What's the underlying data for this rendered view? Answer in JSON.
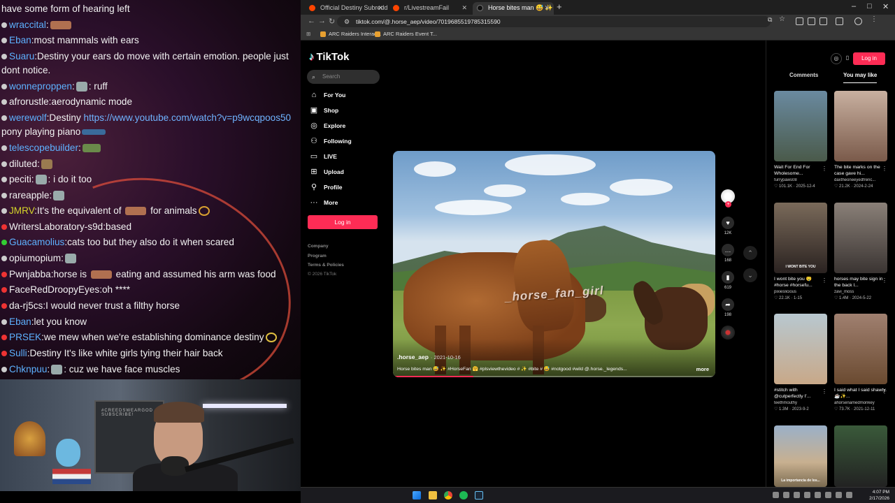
{
  "chat": {
    "lines": [
      {
        "user": "",
        "text": "have some form of hearing left",
        "color": "#f2f2f2"
      },
      {
        "user": "wraccital",
        "text": ":",
        "color": "#5db1ff"
      },
      {
        "user": "Eban",
        "text": ":most mammals with ears",
        "color": "#5db1ff"
      },
      {
        "user": "Suaru",
        "text": ":Destiny your ears do move with certain emotion. people just dont notice.",
        "color": "#5db1ff"
      },
      {
        "user": "wonneproppen",
        "text": ": ruff",
        "color": "#5db1ff"
      },
      {
        "user": "afrorustle",
        "text": ":aerodynamic mode",
        "color": "#f2f2f2"
      },
      {
        "user": "werewolf",
        "text": ":Destiny ",
        "link": "https://www.youtube.com/watch?v=p9wcqpoos50",
        "after": " pony playing piano",
        "color": "#5db1ff"
      },
      {
        "user": "telescopebuilder",
        "text": ":",
        "color": "#5db1ff"
      },
      {
        "user": "diluted",
        "text": ":",
        "color": "#f2f2f2"
      },
      {
        "user": "peciti",
        "text": ": i do it too",
        "color": "#f2f2f2"
      },
      {
        "user": "rareapple",
        "text": ":",
        "color": "#f2f2f2"
      },
      {
        "user": "JMRV",
        "text": ":It's the equivalent of ",
        "after": " for animals",
        "color": "#d6d62a"
      },
      {
        "user": "WritersLaboratory-s9d",
        "text": ":based",
        "color": "#f2f2f2"
      },
      {
        "user": "Guacamolius",
        "text": ":cats too but they also do it when scared",
        "color": "#5db1ff"
      },
      {
        "user": "opiumopium",
        "text": ":",
        "color": "#f2f2f2"
      },
      {
        "user": "Pwnjabba",
        "text": ":horse is ",
        "after": " eating and assumed his arm was food",
        "color": "#f2f2f2"
      },
      {
        "user": "FaceRedDroopyEyes",
        "text": ":oh ****",
        "color": "#f2f2f2"
      },
      {
        "user": "da-rj5cs",
        "text": ":I would never trust a filthy horse",
        "color": "#f2f2f2"
      },
      {
        "user": "Eban",
        "text": ":let you know",
        "color": "#5db1ff"
      },
      {
        "user": "PRSEK",
        "text": ":we mew when we're establishing dominance destiny",
        "color": "#5db1ff"
      },
      {
        "user": "Sulli",
        "text": ":Destiny It's like white girls tying their hair back",
        "color": "#5db1ff"
      },
      {
        "user": "Chknpuu",
        "text": ": cuz we have face muscles",
        "color": "#5db1ff"
      }
    ]
  },
  "webcam": {
    "monitor_text": "#CREEDSWEARGOD SUBSCRIBE!"
  },
  "browser": {
    "tabs": [
      {
        "label": "Official Destiny Subreddit",
        "fav_color": "#ff4500"
      },
      {
        "label": "r/LivestreamFail",
        "fav_color": "#ff4500"
      },
      {
        "label": "Horse bites man 😅 ✨ #Horse",
        "fav_color": "#222222"
      }
    ],
    "new_tab": "+",
    "url": "tiktok.com/@.horse_aep/video/7019685519785315590",
    "bookmarks": [
      "ARC Raiders Interac...",
      "ARC Raiders Event T..."
    ],
    "window_controls": [
      "–",
      "□",
      "✕"
    ]
  },
  "tiktok": {
    "logo": "TikTok",
    "search_placeholder": "Search",
    "nav": [
      {
        "label": "For You",
        "icon": "home-icon",
        "glyph": "⌂"
      },
      {
        "label": "Shop",
        "icon": "shop-icon",
        "glyph": "🛍"
      },
      {
        "label": "Explore",
        "icon": "compass-icon",
        "glyph": "◎"
      },
      {
        "label": "Following",
        "icon": "following-icon",
        "glyph": "👤"
      },
      {
        "label": "LIVE",
        "icon": "live-icon",
        "glyph": "▭"
      },
      {
        "label": "Upload",
        "icon": "upload-icon",
        "glyph": "⊞"
      },
      {
        "label": "Profile",
        "icon": "profile-icon",
        "glyph": "👤"
      },
      {
        "label": "More",
        "icon": "more-icon",
        "glyph": "···"
      }
    ],
    "login_label": "Log in",
    "footer": [
      "Company",
      "Program",
      "Terms & Policies",
      "© 2026 TikTok"
    ],
    "video": {
      "watermark": "_horse_fan_girl",
      "author": ".horse_aep",
      "date": "· 2021-10-16",
      "caption": "Horse bites man 😅 ✨ #HorseFan 🤗 #plsviewthevideo # ✨ #bite # 😅 #notgood #wild @.horse._legends...",
      "more": "more",
      "progress": 0.25
    },
    "actions": [
      {
        "icon": "heart-icon",
        "glyph": "♥",
        "count": "12K"
      },
      {
        "icon": "comment-icon",
        "glyph": "…",
        "count": "168"
      },
      {
        "icon": "bookmark-icon",
        "glyph": "▮",
        "count": "619"
      },
      {
        "icon": "share-icon",
        "glyph": "➦",
        "count": "198"
      }
    ],
    "right_panel": {
      "login_label": "Log in",
      "tabs": [
        "Comments",
        "You may like"
      ],
      "cards": [
        {
          "title": "Wait For End For Wholesome...",
          "user": "furrypaws08",
          "meta": "♡ 101.1K · 2025-12-4",
          "thumb_text": "",
          "bg": "#5a7a8a"
        },
        {
          "title": "The bite marks on the case gave hi...",
          "user": "daxtheoneeyedfrenc...",
          "meta": "♡ 21.2K · 2024-2-24",
          "thumb_text": "",
          "bg": "#8a6a5a"
        },
        {
          "title": "I wont bite you 🤤 #horse #horsefu...",
          "user": "pixieslicious",
          "meta": "♡ 22.1K · 1-15",
          "thumb_text": "I WONT BITE YOU",
          "bg": "#4a3a30"
        },
        {
          "title": "horses may bite sign in the back l...",
          "user": "zavi_moss",
          "meta": "♡ 1.4M · 2024-5-22",
          "thumb_text": "",
          "bg": "#5a5050"
        },
        {
          "title": "#stitch with @cutperfectly I'...",
          "user": "teethmouthy",
          "meta": "♡ 1.3M · 2023-9-2",
          "thumb_text": "",
          "bg": "#9a8a70"
        },
        {
          "title": "I said what I said shawty. ☕✨...",
          "user": "ahorsenamedmonkey",
          "meta": "♡ 73.7K · 2021-12-11",
          "thumb_text": "",
          "bg": "#7a5a40"
        },
        {
          "title": "",
          "user": "",
          "meta": "",
          "thumb_text": "La importancia de los...",
          "bg": "#8a9aaa"
        },
        {
          "title": "",
          "user": "",
          "meta": "",
          "thumb_text": "",
          "bg": "#3a4a3a"
        }
      ]
    }
  },
  "taskbar": {
    "time": "4:07 PM",
    "date": "2/17/2026"
  },
  "colors": {
    "brand": "#fe2c55",
    "link": "#6fb3ff"
  }
}
